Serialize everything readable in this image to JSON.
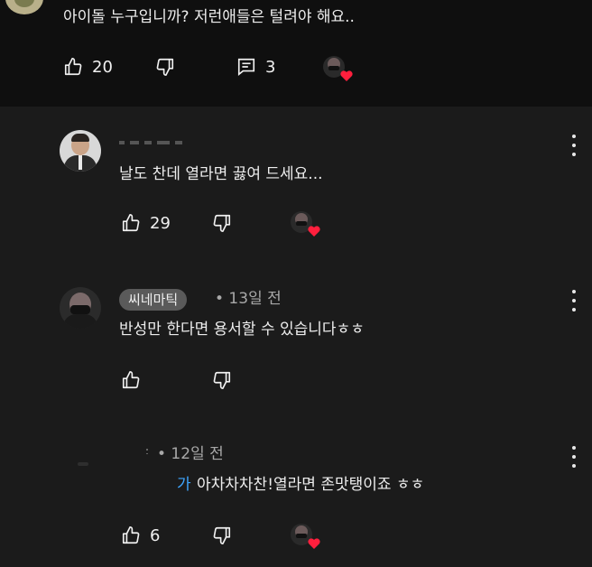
{
  "top_comment": {
    "text": "아이돌 누구입니까? 저런애들은 털려야 해요..",
    "likes": "20",
    "replies": "3"
  },
  "reply1": {
    "text": "날도 찬데 열라면 끓여 드세요...",
    "likes": "29"
  },
  "reply2": {
    "author": "씨네마틱",
    "time": "• 13일 전",
    "text": "반성만 한다면  용서할 수 있습니다ㅎㅎ"
  },
  "reply3": {
    "time": "• 12일 전",
    "mention": "가",
    "text": "아차차차찬!열라면 존맛탱이죠 ㅎㅎ",
    "likes": "6"
  },
  "colors": {
    "background": "#1b1b1b",
    "top_background": "#0f0f0f",
    "heart": "#ff1f3d",
    "mention": "#3ea6ff"
  },
  "icons": [
    "thumbs-up-icon",
    "thumbs-down-icon",
    "reply-comment-icon",
    "heart-icon",
    "more-vert-icon"
  ]
}
